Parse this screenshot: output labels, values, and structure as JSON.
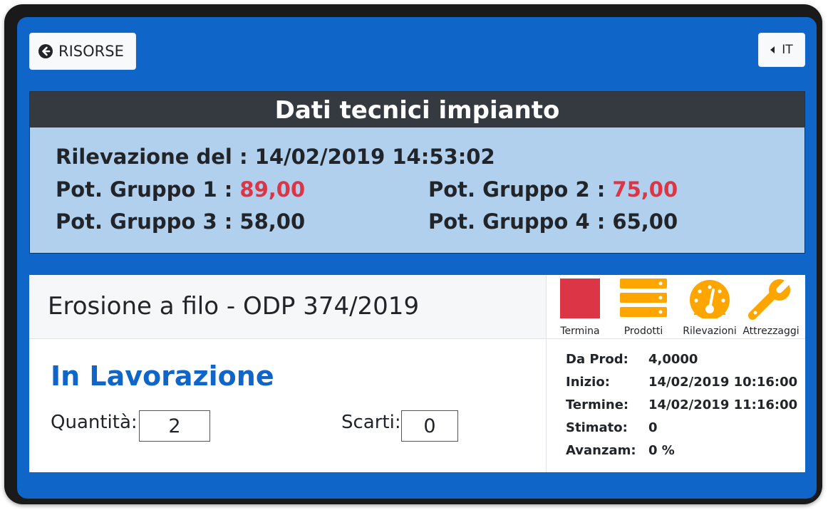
{
  "header": {
    "back_label": "RISORSE",
    "lang_label": "IT"
  },
  "tech": {
    "title": "Dati tecnici impianto",
    "rilevazione_label": "Rilevazione del",
    "rilevazione_value": "14/02/2019 14:53:02",
    "groups": [
      {
        "label": "Pot. Gruppo 1",
        "value": "89,00",
        "alert": true
      },
      {
        "label": "Pot. Gruppo 2",
        "value": "75,00",
        "alert": true
      },
      {
        "label": "Pot. Gruppo 3",
        "value": "58,00",
        "alert": false
      },
      {
        "label": "Pot. Gruppo 4",
        "value": "65,00",
        "alert": false
      }
    ],
    "alert_color": "#dc3545"
  },
  "work": {
    "title": "Erosione a filo - ODP 374/2019",
    "status": "In Lavorazione",
    "quantity_label": "Quantità:",
    "quantity_value": "2",
    "scrap_label": "Scarti:",
    "scrap_value": "0",
    "tools": [
      {
        "label": "Termina",
        "icon": "stop-square-icon",
        "color": "#dc3545"
      },
      {
        "label": "Prodotti",
        "icon": "server-list-icon",
        "color": "#ffa500"
      },
      {
        "label": "Rilevazioni",
        "icon": "gauge-icon",
        "color": "#ffa500"
      },
      {
        "label": "Attrezzaggi",
        "icon": "wrench-icon",
        "color": "#ffa500"
      }
    ],
    "info": [
      {
        "key": "Da Prod:",
        "value": "4,0000"
      },
      {
        "key": "Inizio:",
        "value": "14/02/2019 10:16:00"
      },
      {
        "key": "Termine:",
        "value": "14/02/2019 11:16:00"
      },
      {
        "key": "Stimato:",
        "value": "0"
      },
      {
        "key": "Avanzam:",
        "value": "0 %"
      }
    ]
  },
  "colors": {
    "background": "#0f65c8",
    "panel_header": "#343a40",
    "panel_body": "#b1d0ee",
    "status_text": "#0f65c8"
  }
}
